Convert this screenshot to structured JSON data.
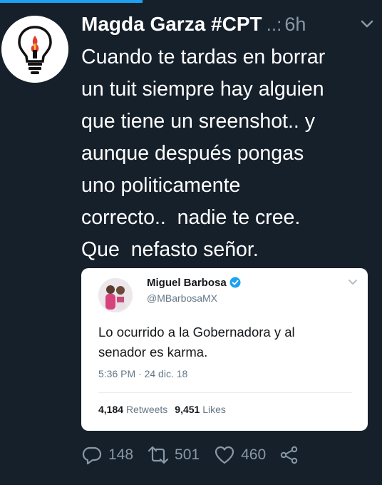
{
  "tweet": {
    "author_name": "Magda Garza #CPT",
    "ellipsis": "..:",
    "time": "6h",
    "text_lines": [
      "Cuando te tardas en borrar",
      "un tuit siempre hay alguien",
      "que tiene un sreenshot.. y",
      "aunque después pongas",
      "uno politicamente",
      "correcto..  nadie te cree.",
      "Que  nefasto señor."
    ],
    "avatar_icon": "lightbulb-icon",
    "menu_icon": "chevron-down-icon"
  },
  "quoted": {
    "name": "Miguel Barbosa",
    "handle": "@MBarbosaMX",
    "text_lines": [
      "Lo ocurrido a la Gobernadora y al",
      "senador es karma."
    ],
    "timestamp": "5:36 PM · 24 dic. 18",
    "retweets_count": "4,184",
    "retweets_label": "Retweets",
    "likes_count": "9,451",
    "likes_label": "Likes",
    "verified_icon": "verified-badge-icon"
  },
  "actions": {
    "replies": "148",
    "retweets": "501",
    "likes": "460"
  },
  "colors": {
    "background": "#16202b",
    "muted_text": "#8899a6",
    "accent": "#1da1f2"
  }
}
